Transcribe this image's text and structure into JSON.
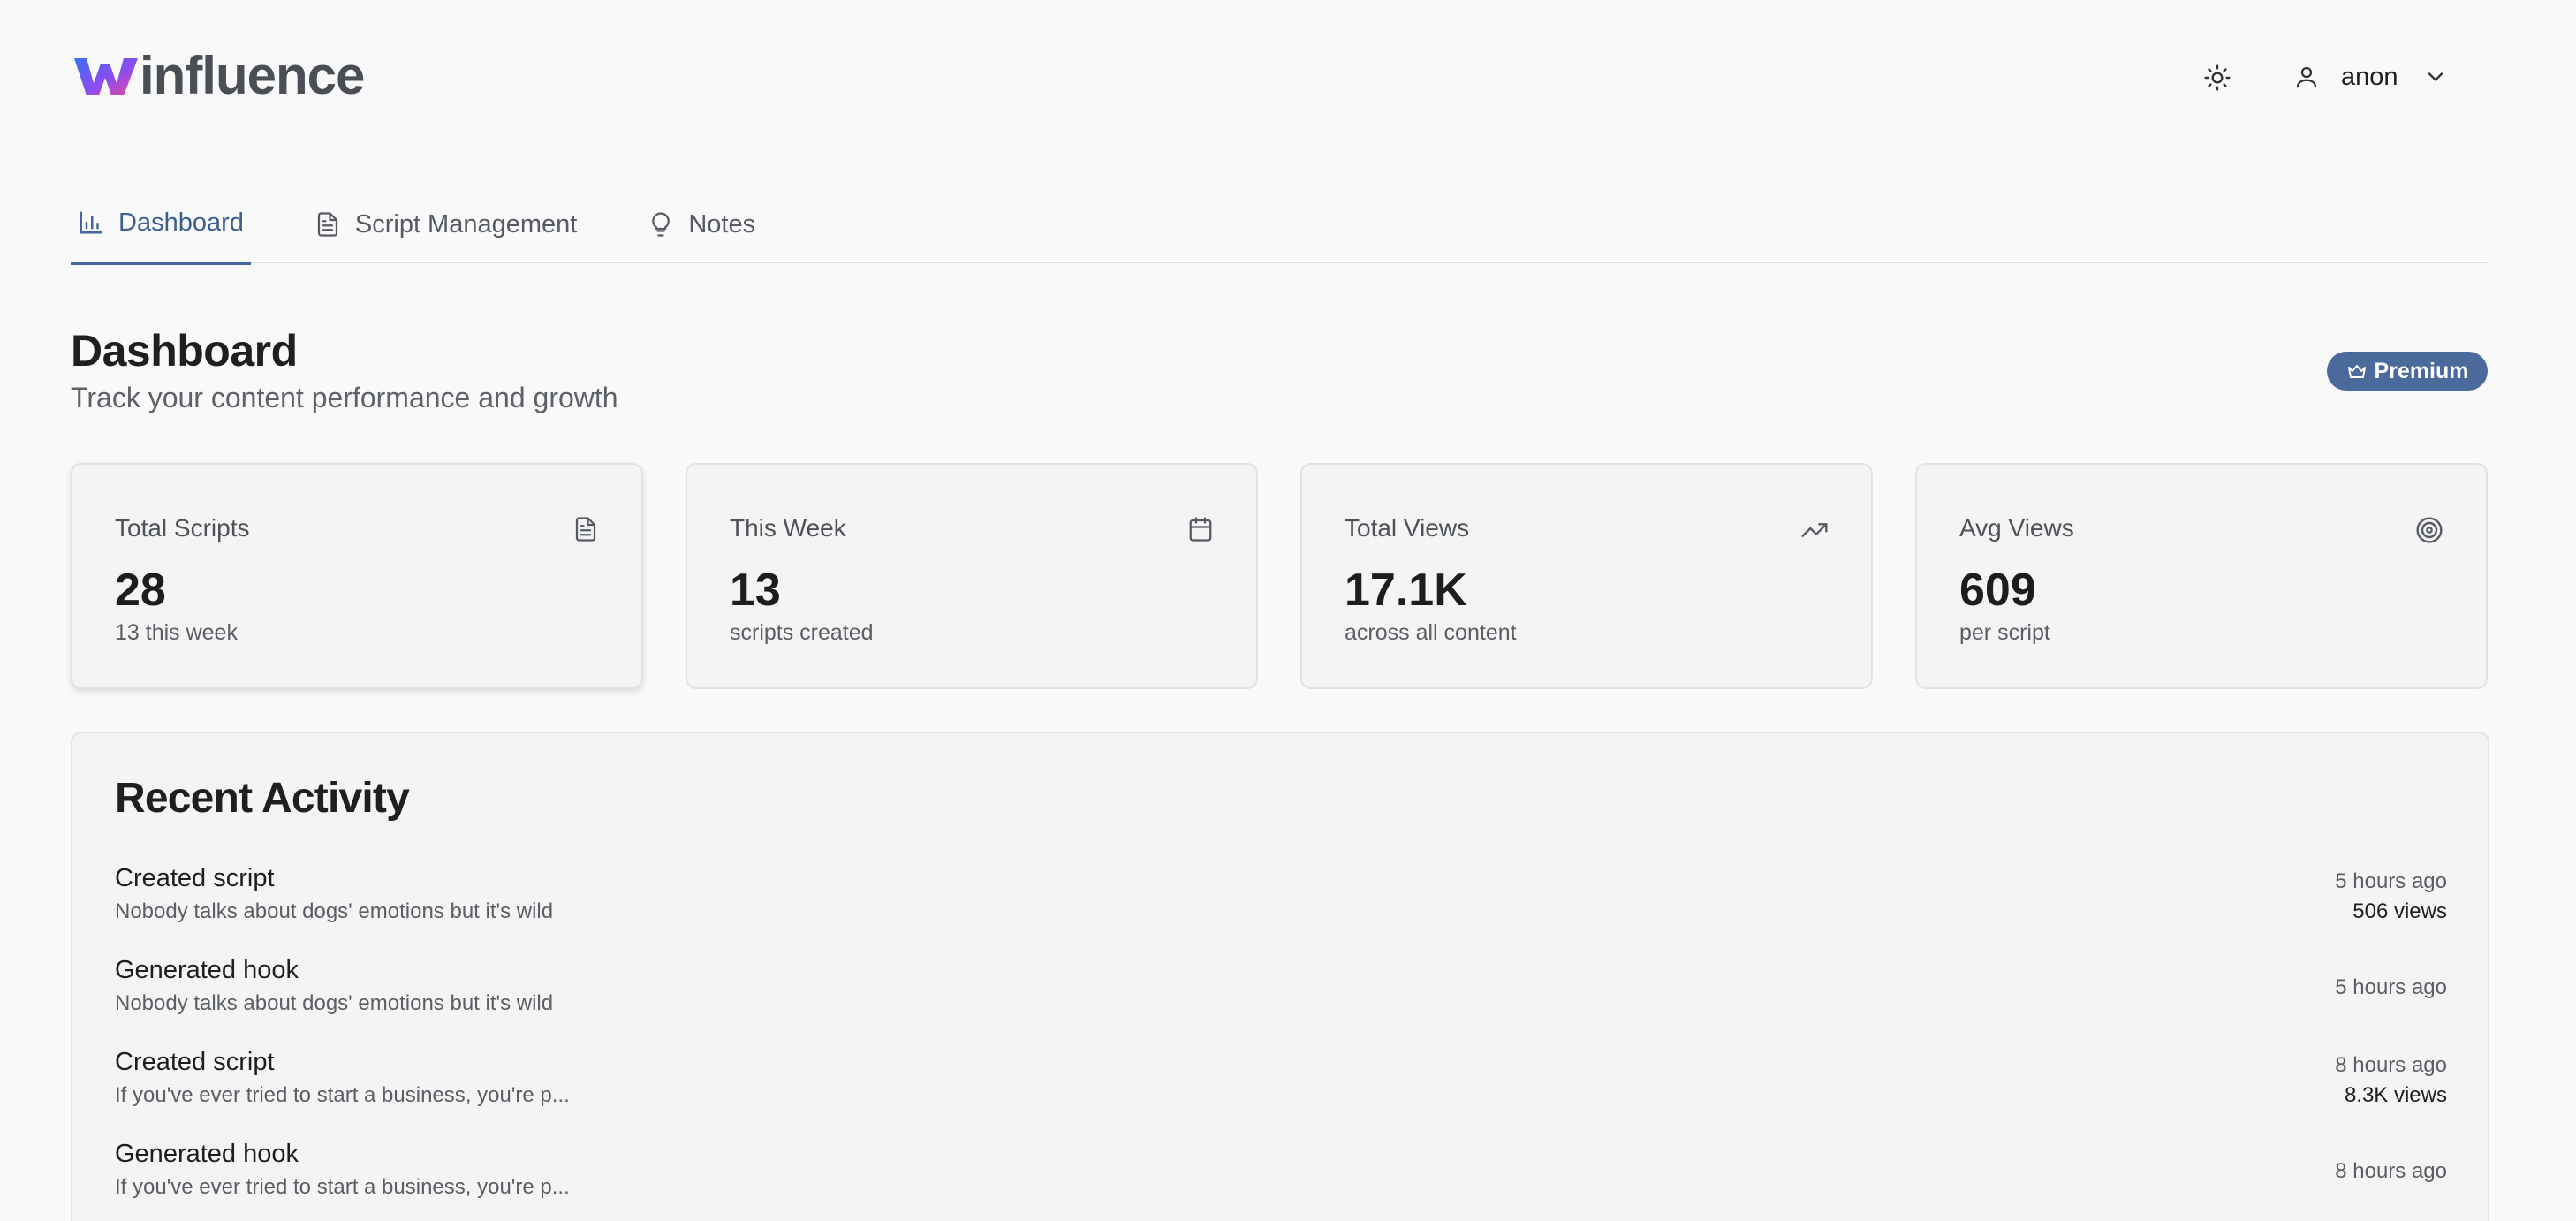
{
  "app": {
    "logo_text": "influence"
  },
  "header": {
    "theme_icon": "sun-icon",
    "user_name": "anon"
  },
  "tabs": [
    {
      "label": "Dashboard",
      "icon": "bar-chart-icon",
      "active": true
    },
    {
      "label": "Script Management",
      "icon": "file-text-icon",
      "active": false
    },
    {
      "label": "Notes",
      "icon": "lightbulb-icon",
      "active": false
    }
  ],
  "page": {
    "title": "Dashboard",
    "subtitle": "Track your content performance and growth",
    "badge": "Premium"
  },
  "stats": [
    {
      "label": "Total Scripts",
      "value": "28",
      "sub": "13 this week",
      "icon": "file-icon"
    },
    {
      "label": "This Week",
      "value": "13",
      "sub": "scripts created",
      "icon": "calendar-icon"
    },
    {
      "label": "Total Views",
      "value": "17.1K",
      "sub": "across all content",
      "icon": "trending-up-icon"
    },
    {
      "label": "Avg Views",
      "value": "609",
      "sub": "per script",
      "icon": "target-icon"
    }
  ],
  "activity": {
    "title": "Recent Activity",
    "items": [
      {
        "action": "Created script",
        "desc": "Nobody talks about dogs' emotions but it's wild",
        "time": "5 hours ago",
        "views": "506 views"
      },
      {
        "action": "Generated hook",
        "desc": "Nobody talks about dogs' emotions but it's wild",
        "time": "5 hours ago",
        "views": ""
      },
      {
        "action": "Created script",
        "desc": "If you've ever tried to start a business, you're p...",
        "time": "8 hours ago",
        "views": "8.3K views"
      },
      {
        "action": "Generated hook",
        "desc": "If you've ever tried to start a business, you're p...",
        "time": "8 hours ago",
        "views": ""
      }
    ]
  },
  "colors": {
    "accent": "#46679b",
    "premium_bg": "#4b6a9c",
    "logo_gradient": [
      "#3b82f6",
      "#a855f7",
      "#ec4899"
    ]
  }
}
